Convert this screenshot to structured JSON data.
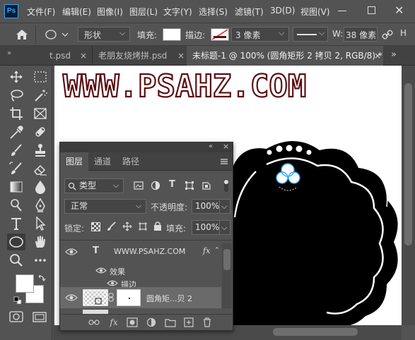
{
  "app": {
    "logo": "Ps"
  },
  "menu": [
    "文件(F)",
    "编辑(E)",
    "图像(I)",
    "图层(L)",
    "文字(Y)",
    "选择(S)",
    "滤镜(T)",
    "3D(D)",
    "视图(V)"
  ],
  "window_controls": {
    "close": "✕"
  },
  "options": {
    "mode": "形状",
    "fill_label": "填充:",
    "stroke_label": "描边:",
    "stroke_width": "3 像素",
    "w_label": "W:",
    "w_value": "38 像素"
  },
  "tabs": [
    {
      "label": "t.psd",
      "active": false
    },
    {
      "label": "老朋友烧烤拼.psd",
      "active": false
    },
    {
      "label": "未标题-1 @ 100% (圆角矩形 2 拷贝 2, RGB/8) *",
      "active": true
    }
  ],
  "tab_close": "×",
  "tab_overflow": "»",
  "canvas": {
    "headline": "WWW.PSAHZ.COM"
  },
  "layers_panel": {
    "tabs": [
      "图层",
      "通道",
      "路径"
    ],
    "collapse": "«",
    "close": "×",
    "filter_kind": "类型",
    "blend_mode": "正常",
    "opacity_label": "不透明度:",
    "opacity_value": "100%",
    "lock_label": "锁定:",
    "fill_label": "填充:",
    "fill_value": "100%",
    "layers": [
      {
        "type_icon": "T",
        "name": "WWW.PSAHZ.COM",
        "fx": "fx"
      },
      {
        "name": "效果"
      },
      {
        "name": "描边"
      },
      {
        "name": "圆角矩...贝 2"
      }
    ]
  },
  "colors": {
    "ui_bg": "#535353",
    "dark": "#3c3c3c",
    "accent": "#31a8ff",
    "headline_fill": "#ffffff",
    "headline_stroke": "#5a0f14",
    "shape": "#000000"
  }
}
